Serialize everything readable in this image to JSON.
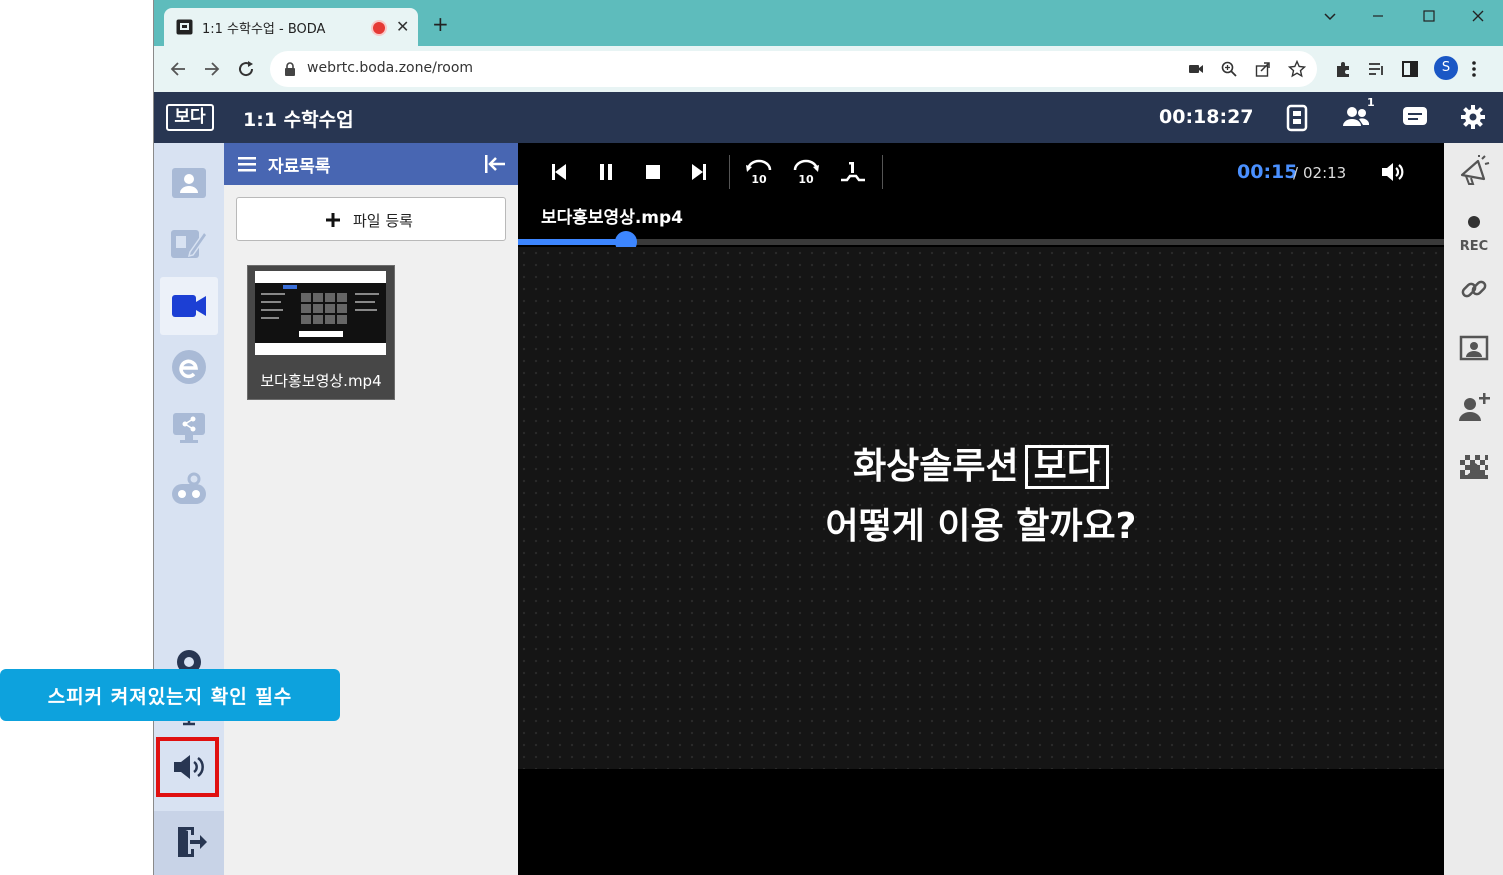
{
  "browser": {
    "tab_title": "1:1 수학수업 - BODA",
    "tab_close": "✕",
    "new_tab": "+",
    "url": "webrtc.boda.zone/room",
    "profile_initial": "S"
  },
  "app": {
    "logo": "보다",
    "room_title": "1:1 수학수업",
    "elapsed_time": "00:18:27",
    "participants_count": "1"
  },
  "doc_panel": {
    "title": "자료목록",
    "upload_button": "파일 등록",
    "files": [
      {
        "name": "보다홍보영상.mp4"
      }
    ]
  },
  "player": {
    "current_time": "00:15",
    "time_separator": "/",
    "total_time": "02:13",
    "media_name": "보다홍보영상.mp4",
    "progress": 0.117,
    "video_text_line1": "화상솔루션",
    "video_text_brand": "보다",
    "video_text_line2": "어떻게 이용 할까요?"
  },
  "right_bar": {
    "rec_label": "REC"
  },
  "tooltip": {
    "text": "스피커 켜져있는지 확인 필수"
  },
  "colors": {
    "header_bg": "#283652",
    "doc_header_bg": "#4866b2",
    "accent_blue": "#3d86ff",
    "tooltip_bg": "#0da2dd",
    "highlight_red": "#e01010"
  }
}
